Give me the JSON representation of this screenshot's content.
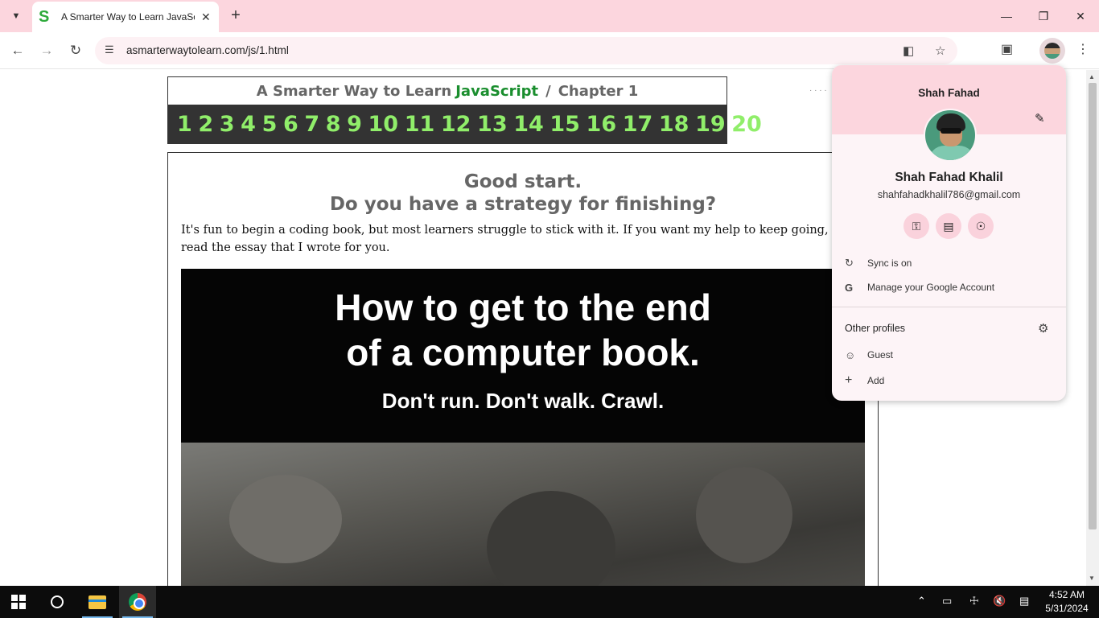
{
  "browser": {
    "tab_title": "A Smarter Way to Learn JavaScript",
    "tab_favicon": "S",
    "url": "asmarterwaytolearn.com/js/1.html"
  },
  "page": {
    "header": {
      "prefix": "A Smarter Way to Learn",
      "brand": "JavaScript",
      "separator": "/",
      "chapter": "Chapter 1"
    },
    "chapters": [
      "1",
      "2",
      "3",
      "4",
      "5",
      "6",
      "7",
      "8",
      "9",
      "10",
      "11",
      "12",
      "13",
      "14",
      "15",
      "16",
      "17",
      "18",
      "19",
      "20"
    ],
    "essay": {
      "heading1": "Good start.",
      "heading2": "Do you have a strategy for finishing?",
      "paragraph": "It's fun to begin a coding book, but most learners struggle to stick with it. If you want my help to keep going, read the essay that I wrote for you.",
      "banner_line1": "How to get to the end",
      "banner_line2": "of a computer book.",
      "banner_sub": "Don't run. Don't walk. Crawl."
    }
  },
  "profile_menu": {
    "header_name": "Shah Fahad",
    "full_name": "Shah Fahad Khalil",
    "email": "shahfahadkhalil786@gmail.com",
    "sync": "Sync is on",
    "manage": "Manage your Google Account",
    "other_profiles": "Other profiles",
    "guest": "Guest",
    "add": "Add"
  },
  "taskbar": {
    "time": "4:52 AM",
    "date": "5/31/2024"
  }
}
